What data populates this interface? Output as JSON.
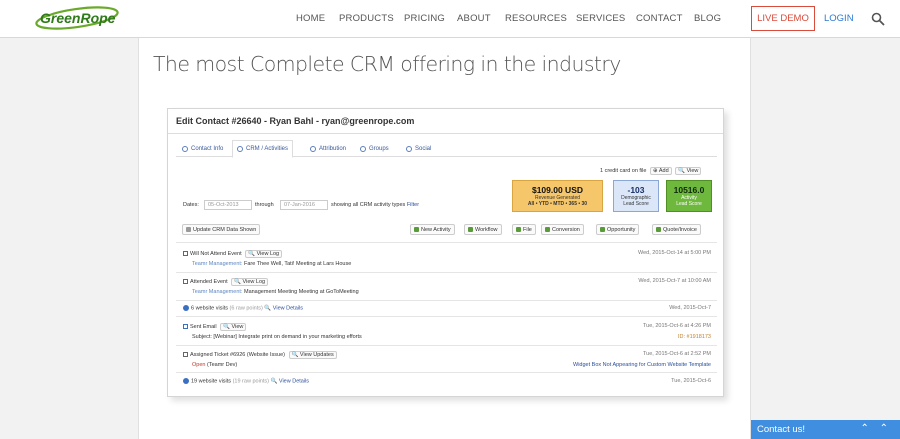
{
  "header": {
    "logo_text": "GreenRope",
    "nav": [
      "HOME",
      "PRODUCTS",
      "PRICING",
      "ABOUT",
      "RESOURCES",
      "SERVICES",
      "CONTACT",
      "BLOG"
    ],
    "live_demo": "LIVE DEMO",
    "login": "LOGIN"
  },
  "main": {
    "headline": "The most Complete CRM offering in the industry"
  },
  "card": {
    "title": "Edit Contact #26640 - Ryan Bahl - ryan@greenrope.com",
    "tabs": [
      "Contact Info",
      "CRM / Activities",
      "Attribution",
      "Groups",
      "Social"
    ],
    "credit_card": "1 credit card on file",
    "add": "Add",
    "view": "View",
    "revenue": {
      "amount": "$109.00 USD",
      "label": "Revenue Generated",
      "filters": "All • YTD • MTD • 365 • 30"
    },
    "demographic": {
      "value": "-103",
      "label1": "Demographic",
      "label2": "Lead Score"
    },
    "activity": {
      "value": "10516.0",
      "label1": "Activity",
      "label2": "Lead Score"
    },
    "dates_label": "Dates:",
    "date_from": "05-Oct-2013",
    "through": "through",
    "date_to": "07-Jan-2016",
    "showing": "showing all CRM activity types",
    "filter": "Filter",
    "update_btn": "Update CRM Data Shown",
    "buttons": [
      "New Activity",
      "Workflow",
      "File",
      "Conversion",
      "Opportunity",
      "Quote/Invoice"
    ],
    "events": {
      "e1": {
        "title": "Will Not Attend Event",
        "btn": "View Log",
        "team": "Teamr Management:",
        "desc": "Fare Thee Well, Tati! Meeting at Lars House",
        "date": "Wed, 2015-Oct-14 at 5:00 PM"
      },
      "e2": {
        "title": "Attended Event",
        "btn": "View Log",
        "team": "Teamr Management:",
        "desc": "Management Meeting Meeting at GoToMeeting",
        "date": "Wed, 2015-Oct-7 at 10:00 AM"
      },
      "e3": {
        "title": "6 website visits",
        "pts": "(6 raw points)",
        "btn": "View Details",
        "date": "Wed, 2015-Oct-7"
      },
      "e4": {
        "title": "Sent Email",
        "btn": "View",
        "subject": "Subject: [Webinar] Integrate print on demand in your marketing efforts",
        "date": "Tue, 2015-Oct-6 at 4:26 PM",
        "id": "ID: #1918173"
      },
      "e5": {
        "title": "Assigned Ticket #6926 (Website Issue)",
        "btn": "View Updates",
        "status": "Open",
        "owner": "(Teamr Dev)",
        "date": "Tue, 2015-Oct-6 at 2:52 PM",
        "link": "Widget Box Not Appearing for Custom Website Template"
      },
      "e6": {
        "title": "19 website visits",
        "pts": "(19 raw points)",
        "btn": "View Details",
        "date": "Tue, 2015-Oct-6"
      }
    },
    "colors": {
      "revenue_bg": "#f6c66a",
      "demographic_bg": "#dbe7f8",
      "activity_bg": "#6fb83e"
    }
  },
  "contact_bar": {
    "label": "Contact us!",
    "controls": "⌃ ⌃"
  }
}
